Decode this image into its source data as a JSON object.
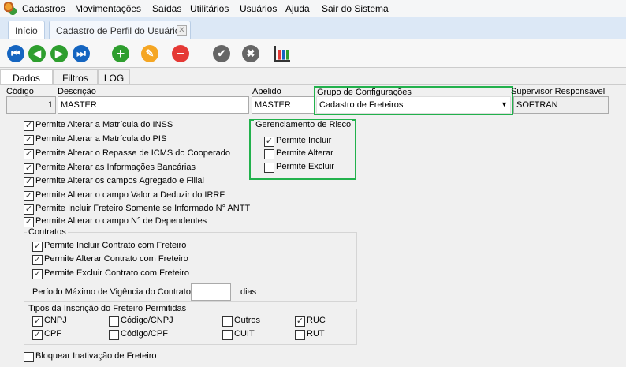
{
  "menu": [
    "Cadastros",
    "Movimentações",
    "Saídas",
    "Utilitários",
    "Usuários",
    "Ajuda",
    "Sair do Sistema"
  ],
  "tabs": {
    "home": "Início",
    "current": "Cadastro de Perfil do Usuário"
  },
  "toolbar": [
    "first-icon",
    "previous-icon",
    "next-icon",
    "last-icon",
    "add-icon",
    "edit-icon",
    "delete-icon",
    "confirm-icon",
    "cancel-icon",
    "chart-settings-icon"
  ],
  "panel_tabs": [
    "Dados",
    "Filtros",
    "LOG"
  ],
  "fields": {
    "codigo": {
      "label": "Código",
      "value": "1"
    },
    "descricao": {
      "label": "Descrição",
      "value": "MASTER"
    },
    "apelido": {
      "label": "Apelido",
      "value": "MASTER"
    },
    "grupo": {
      "label": "Grupo de Configurações",
      "value": "Cadastro de Freteiros"
    },
    "supervisor": {
      "label": "Supervisor Responsável",
      "value": "SOFTRAN"
    }
  },
  "permissions": [
    {
      "label": "Permite Alterar a Matrícula do INSS",
      "checked": true
    },
    {
      "label": "Permite Alterar a Matrícula do PIS",
      "checked": true
    },
    {
      "label": "Permite Alterar o Repasse de ICMS do Cooperado",
      "checked": true
    },
    {
      "label": "Permite Alterar as Informações Bancárias",
      "checked": true
    },
    {
      "label": "Permite Alterar os campos Agregado e Filial",
      "checked": true
    },
    {
      "label": "Permite Alterar o campo Valor a Deduzir do IRRF",
      "checked": true
    },
    {
      "label": "Permite Incluir Freteiro Somente se Informado N° ANTT",
      "checked": true
    },
    {
      "label": "Permite Alterar o campo N° de Dependentes",
      "checked": true
    }
  ],
  "risco": {
    "title": "Gerenciamento de Risco",
    "items": [
      {
        "label": "Permite Incluir",
        "checked": true
      },
      {
        "label": "Permite Alterar",
        "checked": false
      },
      {
        "label": "Permite Excluir",
        "checked": false
      }
    ]
  },
  "contratos": {
    "title": "Contratos",
    "items": [
      {
        "label": "Permite Incluir Contrato com Freteiro",
        "checked": true
      },
      {
        "label": "Permite Alterar Contrato com Freteiro",
        "checked": true
      },
      {
        "label": "Permite Excluir Contrato com Freteiro",
        "checked": true
      }
    ],
    "periodo_label": "Período Máximo de Vigência do Contrato",
    "periodo_value": "",
    "unit": "dias"
  },
  "tipos": {
    "title": "Tipos da Inscrição do Freteiro Permitidas",
    "items": [
      {
        "label": "CNPJ",
        "checked": true
      },
      {
        "label": "Código/CNPJ",
        "checked": false
      },
      {
        "label": "Outros",
        "checked": false
      },
      {
        "label": "RUC",
        "checked": true
      },
      {
        "label": "CPF",
        "checked": true
      },
      {
        "label": "Código/CPF",
        "checked": false
      },
      {
        "label": "CUIT",
        "checked": false
      },
      {
        "label": "RUT",
        "checked": false
      }
    ]
  },
  "bloquear": {
    "label": "Bloquear Inativação de Freteiro",
    "checked": false
  },
  "colors": {
    "highlight": "#22b14c",
    "nav_blue": "#1565c0",
    "green": "#2e9e2e",
    "orange": "#f5a623",
    "red": "#e53935",
    "grey": "#666666"
  }
}
